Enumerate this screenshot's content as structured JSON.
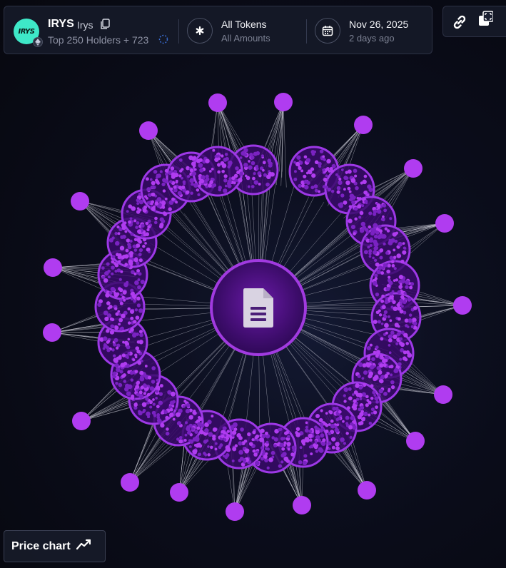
{
  "token": {
    "symbol": "IRYS",
    "name": "Irys",
    "logo_text": "IRYS",
    "holders_text": "Top 250 Holders + 723",
    "logo_color": "#3ee8c8"
  },
  "filters": {
    "tokens_title": "All Tokens",
    "tokens_sub": "All Amounts",
    "date_title": "Nov 26, 2025",
    "date_sub": "2 days ago"
  },
  "price_button": {
    "label": "Price chart"
  },
  "icons": [
    "copy-icon",
    "loading-spinner-icon",
    "asterisk-icon",
    "calendar-icon",
    "link-icon",
    "expand-icon",
    "document-icon",
    "trend-line-icon"
  ],
  "colors": {
    "accent": "#b03cf0",
    "node": "#6a1ea6",
    "background": "#0a0c19"
  }
}
